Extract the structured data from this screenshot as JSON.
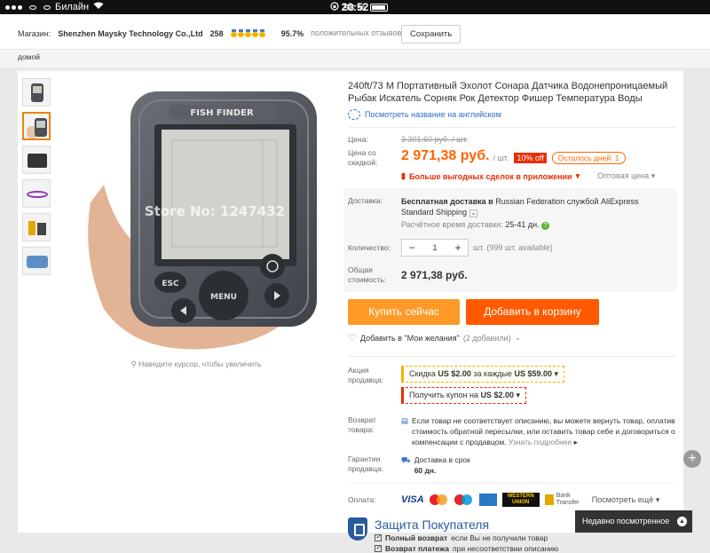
{
  "statusbar": {
    "carrier": "Билайн",
    "time": "20:52",
    "battery": "98 %"
  },
  "store": {
    "label": "Магазин:",
    "name": "Shenzhen Maysky Technology Co.,Ltd",
    "score": "258",
    "positive_pct": "95.7%",
    "positive_label": "положительных отзывов",
    "save_label": "Сохранить"
  },
  "breadcrumb": "домой",
  "gallery": {
    "watermark": "Store No: 1247432",
    "device_label": "FISH FINDER",
    "key_esc": "ESC",
    "key_menu": "MENU",
    "hint": "Наведите курсор, чтобы увеличить"
  },
  "product": {
    "title": "240ft/73 M Портативный Эхолот Сонара Датчика Водонепроницаемый Рыбак Искатель Сорняк Рок Детектор Фишер Температура Воды",
    "english_link": "Посмотреть название на английском"
  },
  "price": {
    "label": "Цена:",
    "old": "3 301,60 руб. / шт.",
    "discount_label": "Цена со скидкой:",
    "new": "2 971,38 руб.",
    "unit": "/ шт.",
    "off_badge": "10% off",
    "days_left": "Осталось дней: 1",
    "app_deal": "Больше выгодных сделок в приложении",
    "wholesale": "Оптовая цена"
  },
  "shipping": {
    "label": "Доставка:",
    "free_prefix": "Бесплатная доставка в",
    "country": "Russian Federation",
    "service_prefix": "службой",
    "service": "AliExpress Standard Shipping",
    "eta_label": "Расчётное время доставки:",
    "eta": "25-41 дн."
  },
  "quantity": {
    "label": "Количество:",
    "value": "1",
    "available": "шт. (999 шт. available)"
  },
  "total": {
    "label": "Общая стоимость:",
    "value": "2 971,38 руб."
  },
  "actions": {
    "buy": "Купить сейчас",
    "cart": "Добавить в корзину",
    "wishlist": "Добавить в \"Мои желания\"",
    "wishlist_count": "(2 добавили)"
  },
  "promo": {
    "label": "Акция продавца:",
    "coupon1_prefix": "Скидка",
    "coupon1_amount": "US $2.00",
    "coupon1_mid": "за каждые",
    "coupon1_min": "US $59.00",
    "coupon2_prefix": "Получить купон на",
    "coupon2_amount": "US $2.00"
  },
  "returns": {
    "label": "Возврат товара:",
    "text": "Если товар не соответствует описанию, вы можете вернуть товар, оплатив стоимость обратной пересылки, или оставить товар себе и договориться о компенсации с продавцом.",
    "more": "Узнать подробнее"
  },
  "guarantee": {
    "label": "Гарантии продавца:",
    "text1": "Доставка в срок",
    "text2": "60 дн."
  },
  "payment": {
    "label": "Оплата:",
    "visa": "VISA",
    "wu": "WESTERN UNION",
    "bank": "Bank Transfer",
    "more": "Посмотреть ещё"
  },
  "protection": {
    "title": "Защита Покупателя",
    "item1_bold": "Полный возврат",
    "item1_rest": "если Вы не получили товар",
    "item2_bold": "Возврат платежа",
    "item2_rest": "при несоответствии описанию"
  },
  "recent": "Недавно посмотренное"
}
